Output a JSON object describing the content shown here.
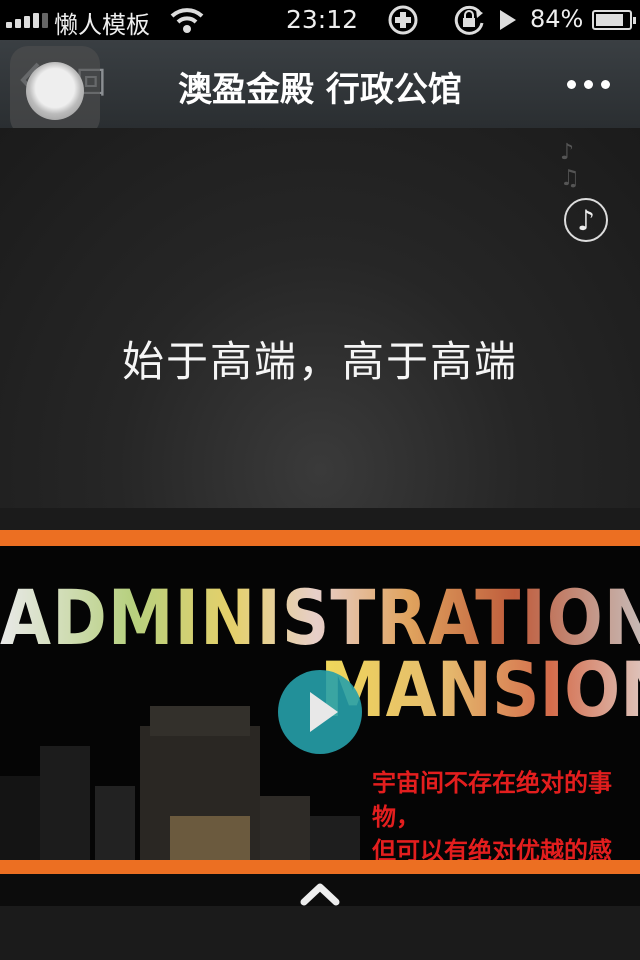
{
  "status_bar": {
    "carrier": "懒人模板",
    "time": "23:12",
    "battery_percent": "84%",
    "battery_level": 0.84,
    "icons": [
      "signal-icon",
      "wifi-icon",
      "plus-circle-icon",
      "rotation-lock-icon",
      "play-icon",
      "battery-icon"
    ]
  },
  "nav": {
    "back_label": "返回",
    "title": "澳盈金殿 行政公馆",
    "more_icon": "more-dots-icon"
  },
  "hero": {
    "slogan": "始于高端，高于高端",
    "music_icon": "music-note-icon"
  },
  "banner": {
    "title_line1": "ADMINISTRATION",
    "title_line2": "MANSION",
    "tagline_line1": "宇宙间不存在绝对的事物，",
    "tagline_line2": "但可以有绝对优越的感觉。",
    "accent_color": "#ec6f22",
    "play_color": "#26a0aa"
  },
  "footer": {
    "up_icon": "chevron-up-icon"
  }
}
